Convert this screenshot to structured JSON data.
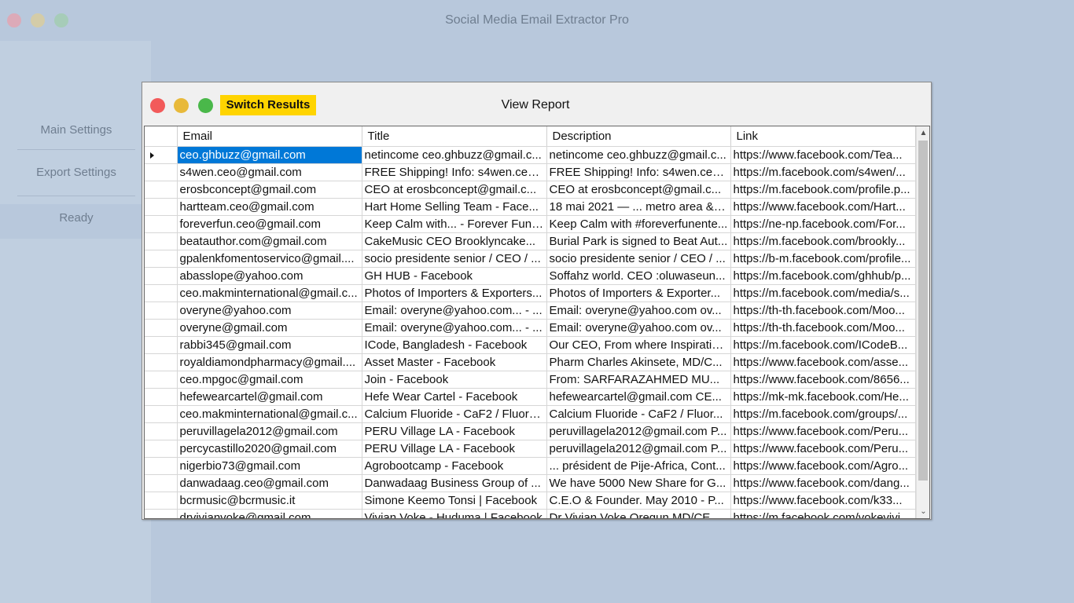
{
  "app": {
    "title": "Social Media Email Extractor Pro"
  },
  "sidebar": {
    "items": [
      {
        "label": "Main Settings"
      },
      {
        "label": "Export Settings"
      },
      {
        "label": "Ready"
      }
    ]
  },
  "report": {
    "title": "View Report",
    "switch_label": "Switch Results",
    "columns": [
      "Email",
      "Title",
      "Description",
      "Link"
    ],
    "rows": [
      [
        "ceo.ghbuzz@gmail.com",
        "netincome ceo.ghbuzz@gmail.c...",
        "netincome ceo.ghbuzz@gmail.c...",
        "https://www.facebook.com/Tea..."
      ],
      [
        "s4wen.ceo@gmail.com",
        "FREE Shipping! Info: s4wen.ceo...",
        "FREE Shipping! Info: s4wen.ceo...",
        "https://m.facebook.com/s4wen/..."
      ],
      [
        "erosbconcept@gmail.com",
        "CEO at erosbconcept@gmail.c...",
        "CEO at erosbconcept@gmail.c...",
        "https://m.facebook.com/profile.p..."
      ],
      [
        "hartteam.ceo@gmail.com",
        "Hart Home Selling Team - Face...",
        "18 mai 2021 — ... metro area & r...",
        "https://www.facebook.com/Hart..."
      ],
      [
        "foreverfun.ceo@gmail.com",
        "Keep Calm with... - Forever Fun ...",
        "Keep Calm with #foreverfunente...",
        "https://ne-np.facebook.com/For..."
      ],
      [
        "beatauthor.com@gmail.com",
        "CakeMusic CEO Brooklyncake...",
        "Burial Park is signed to Beat Aut...",
        "https://m.facebook.com/brookly..."
      ],
      [
        "gpalenkfomentoservico@gmail....",
        "socio presidente senior / CEO / ...",
        "socio presidente senior / CEO / ...",
        "https://b-m.facebook.com/profile..."
      ],
      [
        "abasslope@yahoo.com",
        "GH HUB - Facebook",
        "Soffahz world. CEO :oluwaseun...",
        "https://m.facebook.com/ghhub/p..."
      ],
      [
        "ceo.makminternational@gmail.c...",
        "Photos of Importers & Exporters...",
        "Photos of Importers & Exporter...",
        "https://m.facebook.com/media/s..."
      ],
      [
        "overyne@yahoo.com",
        "Email: overyne@yahoo.com... - ...",
        "Email: overyne@yahoo.com ov...",
        "https://th-th.facebook.com/Moo..."
      ],
      [
        "overyne@gmail.com",
        "Email: overyne@yahoo.com... - ...",
        "Email: overyne@yahoo.com ov...",
        "https://th-th.facebook.com/Moo..."
      ],
      [
        "rabbi345@gmail.com",
        "ICode, Bangladesh - Facebook",
        "Our CEO, From where Inspiratio...",
        "https://m.facebook.com/ICodeB..."
      ],
      [
        "royaldiamondpharmacy@gmail....",
        "Asset Master - Facebook",
        "Pharm Charles Akinsete, MD/C...",
        "https://www.facebook.com/asse..."
      ],
      [
        "ceo.mpgoc@gmail.com",
        "Join - Facebook",
        "From: SARFARAZAHMED MU...",
        "https://www.facebook.com/8656..."
      ],
      [
        "hefewearcartel@gmail.com",
        "Hefe Wear Cartel - Facebook",
        "hefewearcartel@gmail.com CE...",
        "https://mk-mk.facebook.com/He..."
      ],
      [
        "ceo.makminternational@gmail.c...",
        "Calcium Fluoride - CaF2 / Fluors...",
        "Calcium Fluoride - CaF2 / Fluor...",
        "https://m.facebook.com/groups/..."
      ],
      [
        "peruvillagela2012@gmail.com",
        "PERU Village LA - Facebook",
        "peruvillagela2012@gmail.com P...",
        "https://www.facebook.com/Peru..."
      ],
      [
        "percycastillo2020@gmail.com",
        "PERU Village LA - Facebook",
        "peruvillagela2012@gmail.com P...",
        "https://www.facebook.com/Peru..."
      ],
      [
        "nigerbio73@gmail.com",
        "Agrobootcamp - Facebook",
        "... président de Pije-Africa, Cont...",
        "https://www.facebook.com/Agro..."
      ],
      [
        "danwadaag.ceo@gmail.com",
        "Danwadaag Business Group of ...",
        "We have 5000 New Share for G...",
        "https://www.facebook.com/dang..."
      ],
      [
        "bcrmusic@bcrmusic.it",
        "Simone Keemo Tonsi | Facebook",
        "C.E.O & Founder. May 2010 - P...",
        "https://www.facebook.com/k33..."
      ],
      [
        "drvivianvoke@gmail.com",
        "Vivian Voke - Huduma | Facebook",
        "Dr Vivian Voke Oregun MD/CE...",
        "https://m.facebook.com/vokevivi..."
      ]
    ]
  }
}
